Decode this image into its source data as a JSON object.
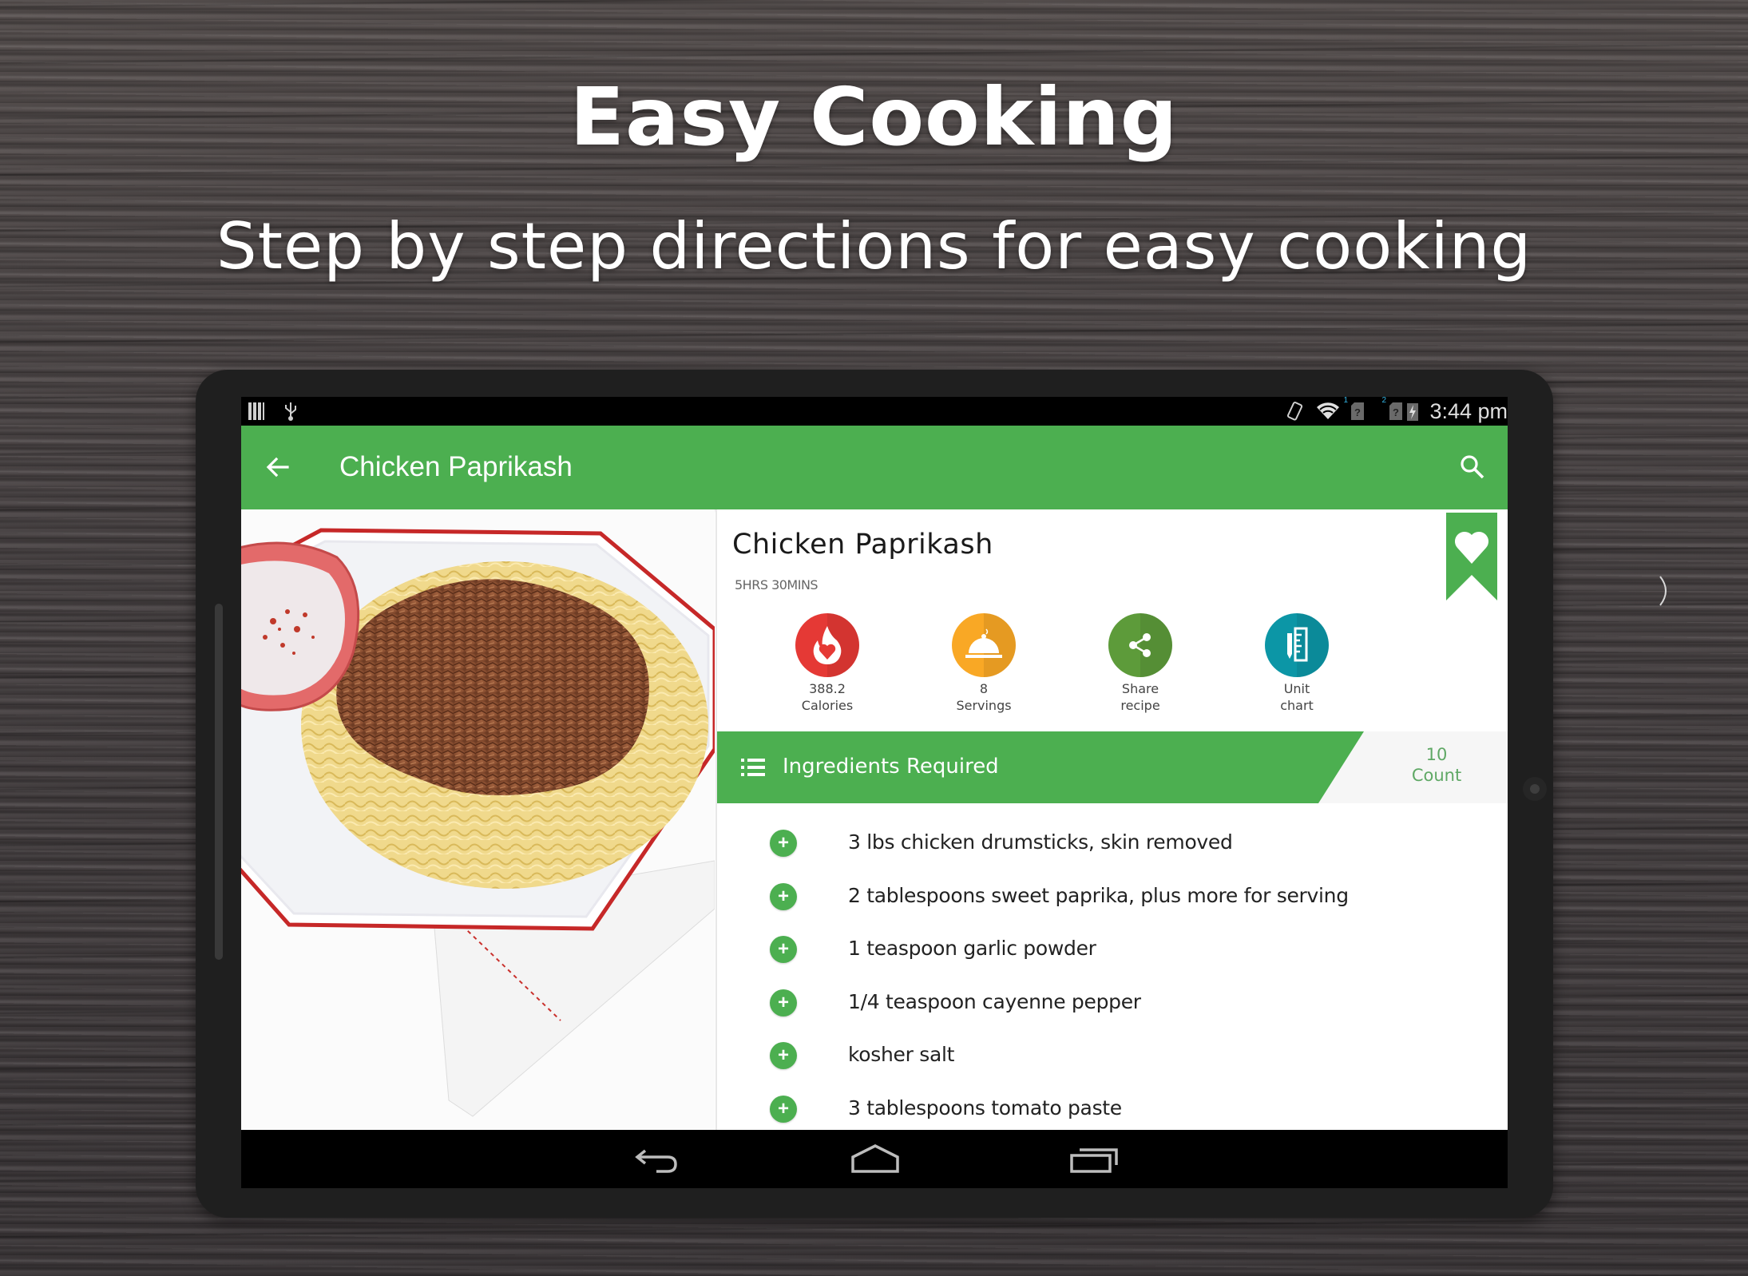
{
  "promo": {
    "title": "Easy Cooking",
    "subtitle": "Step by step directions for easy cooking"
  },
  "status_bar": {
    "left_icons": [
      "signal-bars-icon",
      "usb-icon"
    ],
    "right_icons": [
      "screen-rotation-icon",
      "wifi-icon",
      "sim-card-1-icon",
      "sim-card-2-icon",
      "battery-charging-icon"
    ],
    "sim1_label": "1",
    "sim2_label": "2",
    "time": "3:44 pm"
  },
  "app_bar": {
    "title": "Chicken Paprikash",
    "back_icon": "arrow-left-icon",
    "search_icon": "search-icon",
    "color": "#4caf50"
  },
  "recipe": {
    "image_alt": "Chicken Paprikash on egg noodles with sour cream",
    "title": "Chicken Paprikash",
    "time": "5HRS 30MINS",
    "favorite_icon": "heart-bookmark-icon",
    "actions": [
      {
        "icon": "calorie-flame-icon",
        "line1": "388.2",
        "line2": "Calories",
        "color": "#e53935"
      },
      {
        "icon": "serving-cloche-icon",
        "line1": "8",
        "line2": "Servings",
        "color": "#f9a825"
      },
      {
        "icon": "share-icon",
        "line1": "Share",
        "line2": "recipe",
        "color": "#5d9b3a"
      },
      {
        "icon": "unit-chart-icon",
        "line1": "Unit",
        "line2": "chart",
        "color": "#0c96a6"
      }
    ]
  },
  "ingredients": {
    "header_label": "Ingredients Required",
    "count_value": "10",
    "count_label": "Count",
    "items": [
      "3 lbs chicken drumsticks, skin removed",
      "2 tablespoons sweet paprika, plus more for serving",
      "1 teaspoon garlic powder",
      "1/4 teaspoon cayenne pepper",
      "kosher salt",
      "3 tablespoons tomato paste"
    ]
  },
  "nav_bar": {
    "back": "nav-back-icon",
    "home": "nav-home-icon",
    "recents": "nav-recents-icon"
  }
}
